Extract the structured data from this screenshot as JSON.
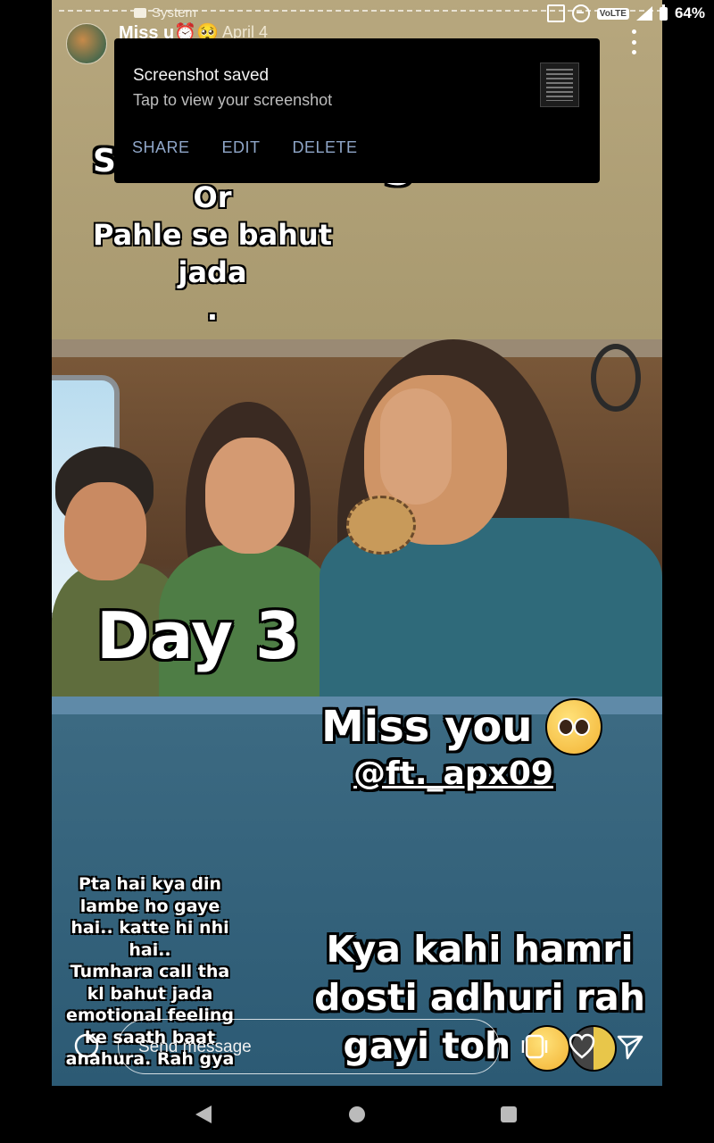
{
  "status_bar": {
    "notification_label": "System",
    "network_badge": "VoLTE",
    "network_type": "4G",
    "battery": "64%"
  },
  "story_header": {
    "username": "Miss u⏰🥺",
    "date": "April 4"
  },
  "toast": {
    "title": "Screenshot saved",
    "subtitle": "Tap to view your screenshot",
    "actions": [
      "SHARE",
      "EDIT",
      "DELETE"
    ]
  },
  "story_text": {
    "top_partial_left": "S",
    "top_partial_right": "5",
    "top_lines": [
      "Or",
      "Pahle se bahut",
      "jada",
      "."
    ],
    "day_label": "Day 3",
    "miss_you": "Miss you",
    "handle": "@ft._apx09",
    "left_caption": [
      "Pta hai kya din",
      "lambe ho gaye",
      "hai.. katte hi nhi",
      "hai..",
      "Tumhara call tha",
      "kl bahut jada",
      "emotional feeling",
      "ke saath baat",
      "anahura. Rah gya"
    ],
    "right_caption": [
      "Kya kahi hamri",
      "dosti adhuri rah",
      "gayi toh"
    ]
  },
  "bottom_bar": {
    "message_placeholder": "Send message"
  },
  "icons": {
    "camera": "camera-icon",
    "repost": "repost-icon",
    "like": "heart-icon",
    "share": "send-icon",
    "more": "more-vertical-icon"
  }
}
